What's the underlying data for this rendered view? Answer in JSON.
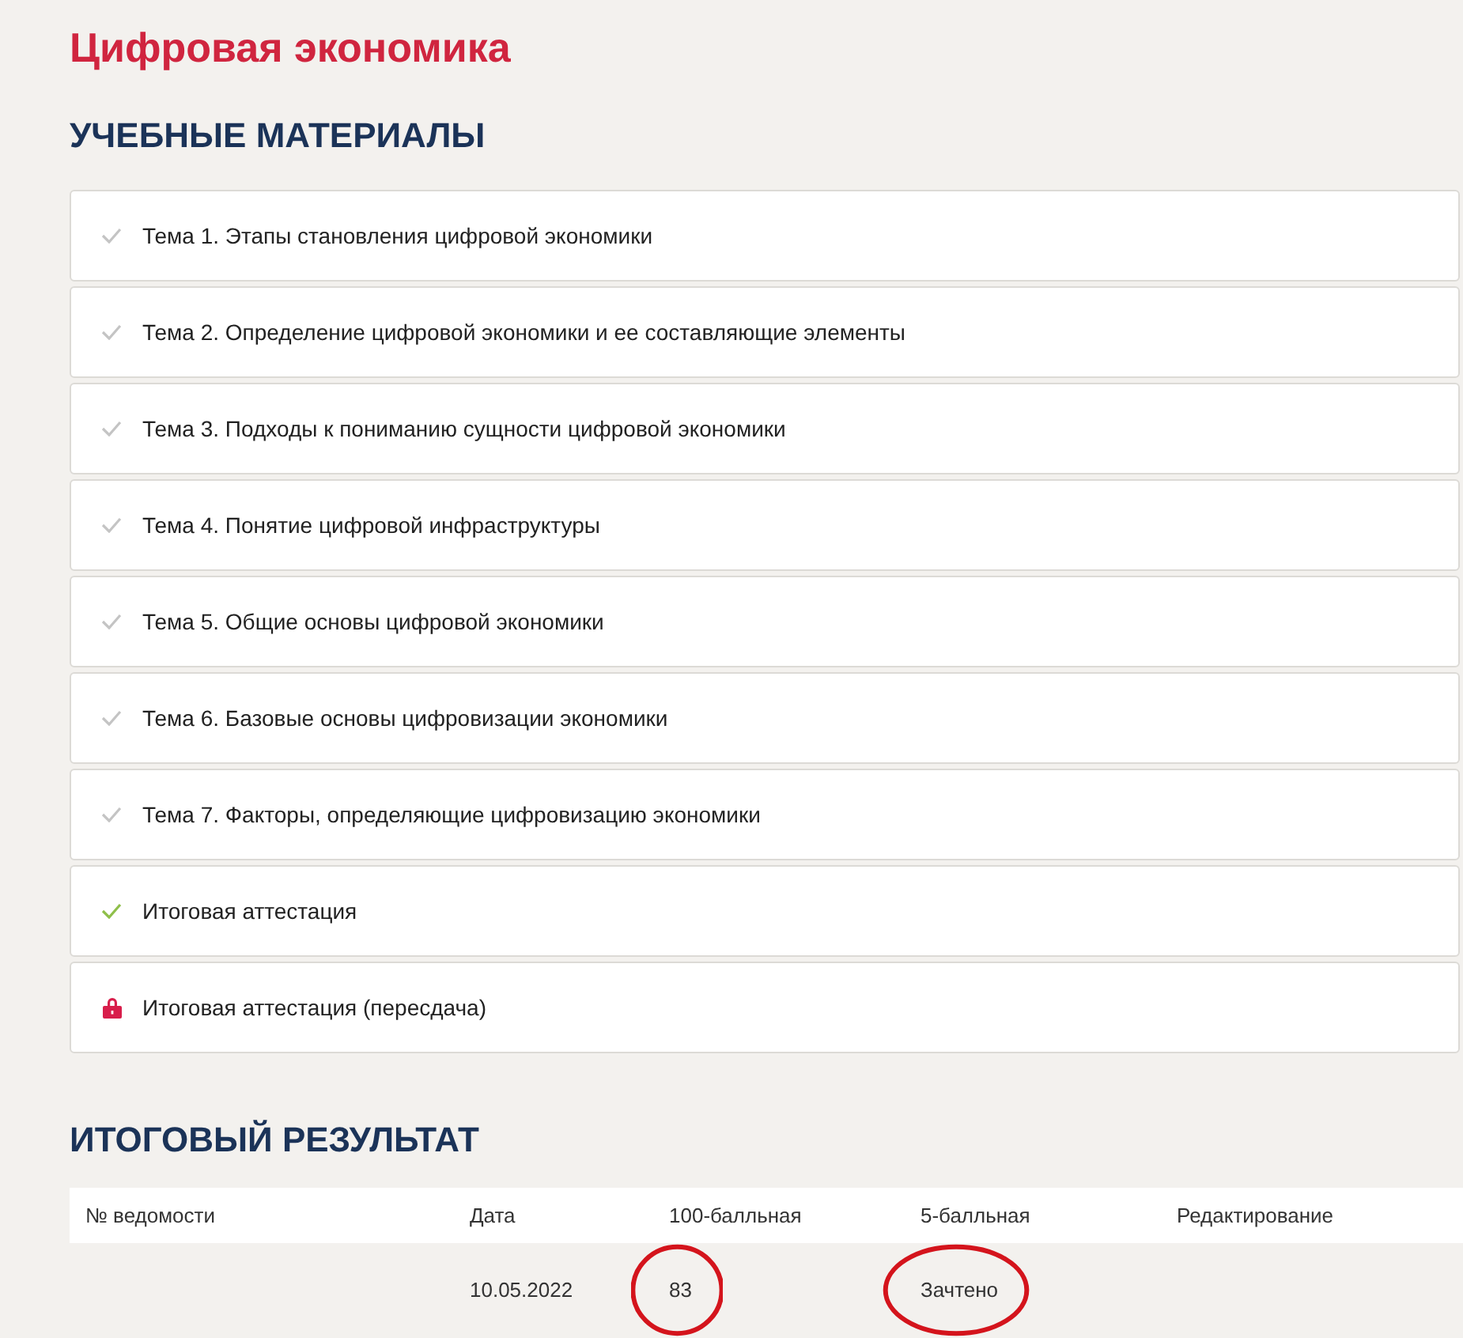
{
  "page": {
    "title": "Цифровая экономика"
  },
  "materials": {
    "heading": "УЧЕБНЫЕ МАТЕРИАЛЫ",
    "items": [
      {
        "label": "Тема 1. Этапы становления цифровой экономики",
        "kind": "viewed"
      },
      {
        "label": "Тема 2. Определение цифровой экономики и ее составляющие элементы",
        "kind": "viewed"
      },
      {
        "label": "Тема 3. Подходы к пониманию сущности цифровой экономики",
        "kind": "viewed"
      },
      {
        "label": "Тема 4. Понятие цифровой инфраструктуры",
        "kind": "viewed"
      },
      {
        "label": "Тема 5. Общие основы цифровой экономики",
        "kind": "viewed"
      },
      {
        "label": "Тема 6. Базовые основы цифровизации экономики",
        "kind": "viewed"
      },
      {
        "label": "Тема 7. Факторы, определяющие цифровизацию экономики",
        "kind": "viewed"
      },
      {
        "label": "Итоговая аттестация",
        "kind": "passed"
      },
      {
        "label": "Итоговая аттестация (пересдача)",
        "kind": "locked"
      }
    ]
  },
  "results": {
    "heading": "ИТОГОВЫЙ РЕЗУЛЬТАТ",
    "columns": [
      "№ ведомости",
      "Дата",
      "100-балльная",
      "5-балльная",
      "Редактирование"
    ],
    "rows": [
      {
        "cells": [
          null,
          {
            "text": "10.05.2022",
            "circled": false
          },
          {
            "text": "83",
            "circled": true
          },
          {
            "text": "Зачтено",
            "circled": true
          },
          null
        ]
      }
    ]
  }
}
